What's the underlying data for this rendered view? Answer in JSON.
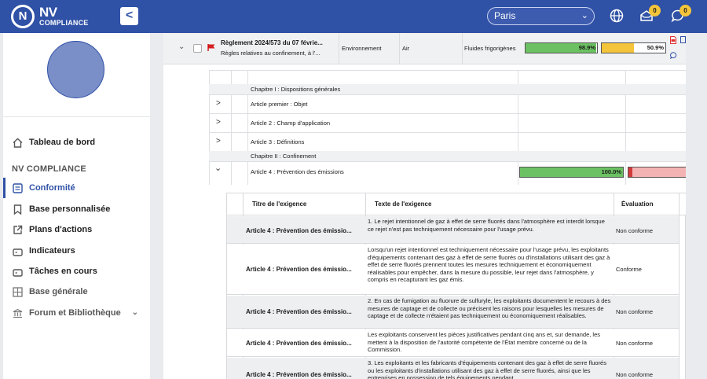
{
  "header": {
    "logo_mark": "N",
    "logo_title": "NV",
    "logo_subtitle": "COMPLIANCE",
    "collapse_label": "<",
    "site": "Paris",
    "notifications_count": "0",
    "messages_count": "0"
  },
  "sidebar": {
    "section_title": "NV COMPLIANCE",
    "items": [
      {
        "label": "Tableau de bord",
        "icon": "home-icon"
      },
      {
        "label": "Conformité",
        "icon": "checklist-icon"
      },
      {
        "label": "Base personnalisée",
        "icon": "bookmark-icon"
      },
      {
        "label": "Plans d'actions",
        "icon": "external-link-icon"
      },
      {
        "label": "Indicateurs",
        "icon": "monitor-icon"
      },
      {
        "label": "Tâches en cours",
        "icon": "monitor-icon"
      },
      {
        "label": "Base générale",
        "icon": "grid-icon"
      },
      {
        "label": "Forum et Bibliothèque",
        "icon": "bank-icon"
      }
    ]
  },
  "regulation": {
    "title": "Règlement 2024/573 du 07 févrie...",
    "subtitle": "Règles relatives au confinement, à l'...",
    "domain": "Environnement",
    "theme": "Air",
    "subtheme": "Fluides frigorigènes",
    "progress_1": 98.9,
    "progress_1_label": "98.9%",
    "progress_2": 50.9,
    "progress_2_label": "50.9%"
  },
  "articles": [
    {
      "label": "Chapitre I : Dispositions générales",
      "type": "chapter"
    },
    {
      "label": "Article premier : Objet",
      "type": "article",
      "expander": ">"
    },
    {
      "label": "Article 2 : Champ d'application",
      "type": "article",
      "expander": ">"
    },
    {
      "label": "Article 3 : Définitions",
      "type": "article",
      "expander": ">"
    },
    {
      "label": "Chapitre II : Confinement",
      "type": "chapter"
    },
    {
      "label": "Article 4 : Prévention des émissions",
      "type": "article",
      "expander": "v",
      "progress": 100.0,
      "progress_label": "100.0%"
    }
  ],
  "requirements": {
    "columns": [
      "Titre de l'exigence",
      "Texte de l'exigence",
      "Évaluation"
    ],
    "rows": [
      {
        "title": "Article 4 : Prévention des émissio...",
        "text": "1. Le rejet intentionnel de gaz à effet de serre fluorés dans l'atmosphère est interdit lorsque ce rejet n'est pas techniquement nécessaire pour l'usage prévu.",
        "evaluation": "Non conforme"
      },
      {
        "title": "Article 4 : Prévention des émissio...",
        "text": "Lorsqu'un rejet intentionnel est techniquement nécessaire pour l'usage prévu, les exploitants d'équipements contenant des gaz à effet de serre fluorés ou d'installations utilisant des gaz à effet de serre fluorés prennent toutes les mesures techniquement et économiquement réalisables pour empêcher, dans la mesure du possible, leur rejet dans l'atmosphère, y compris en recapturant les gaz émis.",
        "evaluation": "Conforme"
      },
      {
        "title": "Article 4 : Prévention des émissio...",
        "text": "2. En cas de fumigation au fluorure de sulfuryle, les exploitants documentent le recours à des mesures de captage et de collecte ou précisent les raisons pour lesquelles les mesures de captage et de collecte n'étaient pas techniquement ou économiquement réalisables.",
        "evaluation": "Non conforme"
      },
      {
        "title": "Article 4 : Prévention des émissio...",
        "text": "Les exploitants conservent les pièces justificatives pendant cinq ans et, sur demande, les mettent à la disposition de l'autorité compétente de l'État membre concerné ou de la Commission.",
        "evaluation": "Non conforme"
      },
      {
        "title": "Article 4 : Prévention des émissio...",
        "text": "3. Les exploitants et les fabricants d'équipements contenant des gaz à effet de serre fluorés ou les exploitants d'installations utilisant des gaz à effet de serre fluorés, ainsi que les entreprises en possession de tels équipements pendant",
        "evaluation": "Non conforme"
      }
    ]
  },
  "colors": {
    "brand": "#2f51a6",
    "ok": "#6cc262",
    "warn": "#f4c53a",
    "bad": "#f4b3b3",
    "bad_strong": "#d33a3a"
  }
}
